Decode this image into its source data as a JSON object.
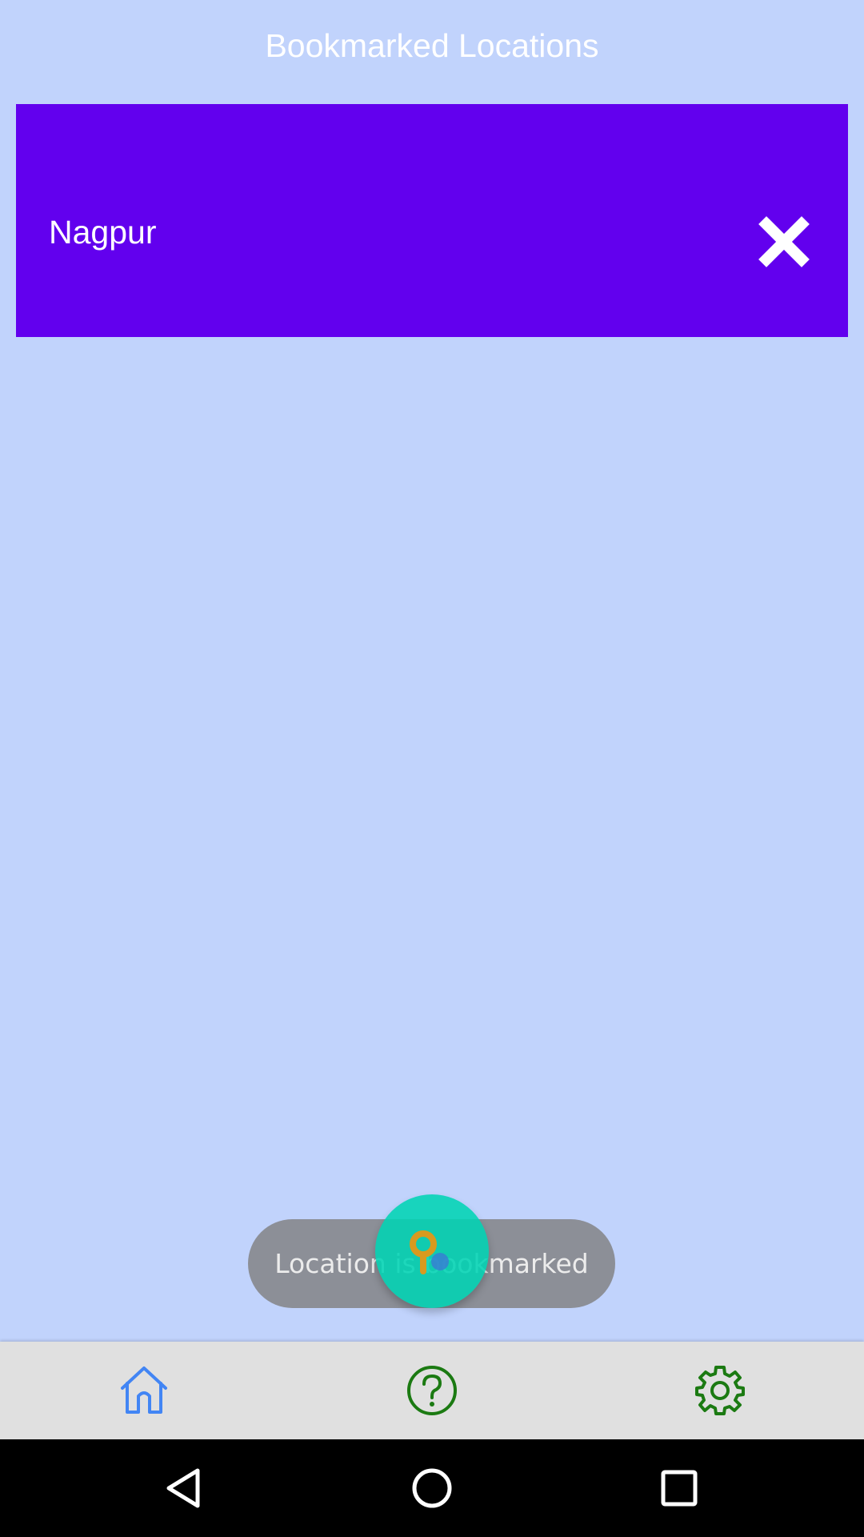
{
  "header": {
    "title": "Bookmarked Locations"
  },
  "bookmarks": [
    {
      "name": "Nagpur",
      "color": "#6200ee"
    }
  ],
  "toast": {
    "message": "Location is bookmarked"
  },
  "fab": {
    "icon": "location-pin-icon",
    "color": "#00d4b4"
  },
  "bottom_nav": {
    "items": [
      {
        "icon": "home-icon",
        "color": "#4285f4"
      },
      {
        "icon": "help-icon",
        "color": "#1b7a12"
      },
      {
        "icon": "settings-gear-icon",
        "color": "#1b7a12"
      }
    ]
  },
  "system_nav": {
    "items": [
      {
        "icon": "back-icon"
      },
      {
        "icon": "home-circle-icon"
      },
      {
        "icon": "recents-icon"
      }
    ]
  },
  "colors": {
    "background": "#c1d3fc",
    "card": "#6200ee",
    "bottom_bar": "#e0e0e0",
    "system_bar": "#000000"
  }
}
